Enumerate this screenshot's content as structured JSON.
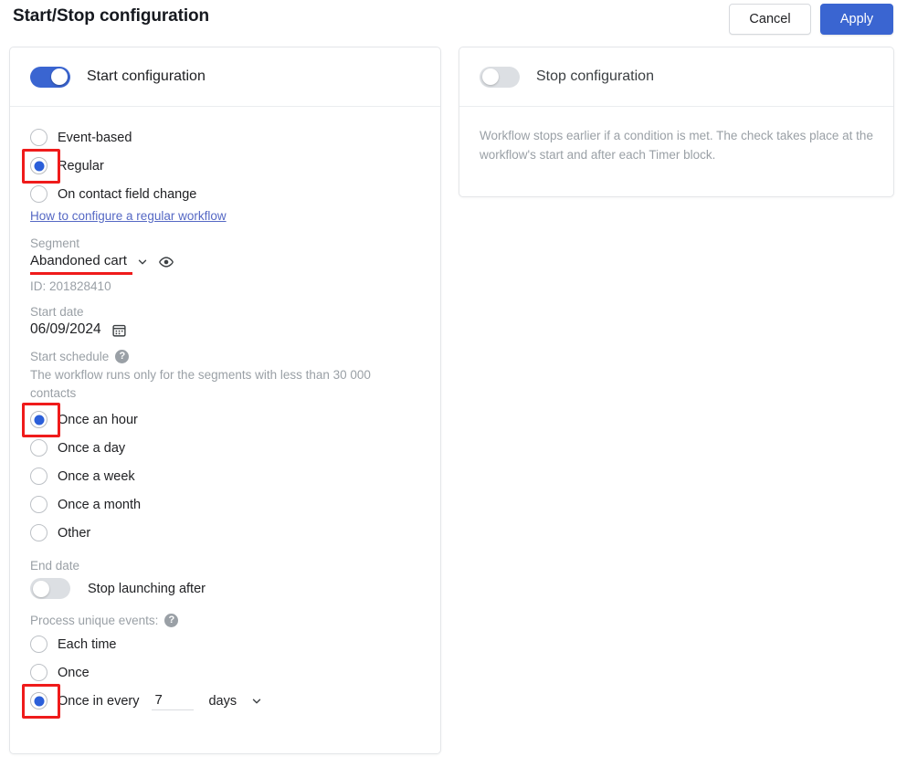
{
  "header": {
    "title": "Start/Stop configuration",
    "cancel_label": "Cancel",
    "apply_label": "Apply"
  },
  "colors": {
    "accent_blue": "#3a65d1",
    "radio_blue": "#2b5fd9",
    "annotation_red": "#ef1b1b",
    "link_blue": "#5568c4",
    "muted_gray": "#9aa0a6"
  },
  "start_card": {
    "toggle_label": "Start configuration",
    "toggle_state": "on",
    "trigger_type": {
      "options": [
        {
          "label": "Event-based",
          "selected": false,
          "flagged": false
        },
        {
          "label": "Regular",
          "selected": true,
          "flagged": true
        },
        {
          "label": "On contact field change",
          "selected": false,
          "flagged": false
        }
      ],
      "help_link": "How to configure a regular workflow"
    },
    "segment": {
      "label": "Segment",
      "value": "Abandoned cart",
      "chevron_icon": "chevron-down-icon",
      "preview_icon": "eye-icon",
      "id_text": "ID: 201828410"
    },
    "start_date": {
      "label": "Start date",
      "value": "06/09/2024",
      "calendar_icon": "calendar-icon"
    },
    "start_schedule": {
      "label": "Start schedule",
      "help_icon": "help-icon",
      "hint": "The workflow runs only for the segments with less than 30 000 contacts",
      "options": [
        {
          "label": "Once an hour",
          "selected": true,
          "flagged": true
        },
        {
          "label": "Once a day",
          "selected": false,
          "flagged": false
        },
        {
          "label": "Once a week",
          "selected": false,
          "flagged": false
        },
        {
          "label": "Once a month",
          "selected": false,
          "flagged": false
        },
        {
          "label": "Other",
          "selected": false,
          "flagged": false
        }
      ]
    },
    "end_date": {
      "label": "End date",
      "toggle_label": "Stop launching after",
      "toggle_state": "off"
    },
    "process_unique_events": {
      "label": "Process unique events:",
      "help_icon": "help-icon",
      "options": [
        {
          "label": "Each time",
          "selected": false,
          "flagged": false
        },
        {
          "label": "Once",
          "selected": false,
          "flagged": false
        },
        {
          "label": "Once in every",
          "selected": true,
          "flagged": true
        }
      ],
      "interval_value": "7",
      "interval_unit": "days",
      "unit_chevron_icon": "chevron-down-icon"
    }
  },
  "stop_card": {
    "toggle_label": "Stop configuration",
    "toggle_state": "off",
    "description": "Workflow stops earlier if a condition is met. The check takes place at the workflow's start and after each Timer block."
  }
}
